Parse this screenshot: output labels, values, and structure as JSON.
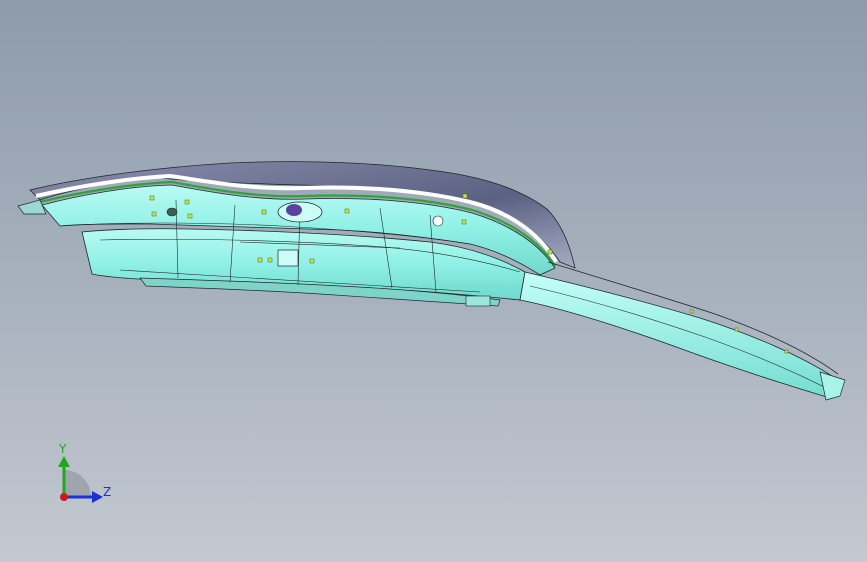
{
  "viewport": {
    "background_top": "#8d9bab",
    "background_bottom": "#c4c8d0"
  },
  "model": {
    "body_color": "#8ff0e6",
    "edge_color": "#1c2a2a",
    "top_surface_color": "#6a6f8f",
    "accent_line_color": "#2fa33a",
    "marker_color": "#c7e34a"
  },
  "triad": {
    "y_label": "Y",
    "z_label": "Z",
    "y_color": "#1fa81f",
    "z_color": "#1d2fd6",
    "x_color": "#d01818"
  }
}
